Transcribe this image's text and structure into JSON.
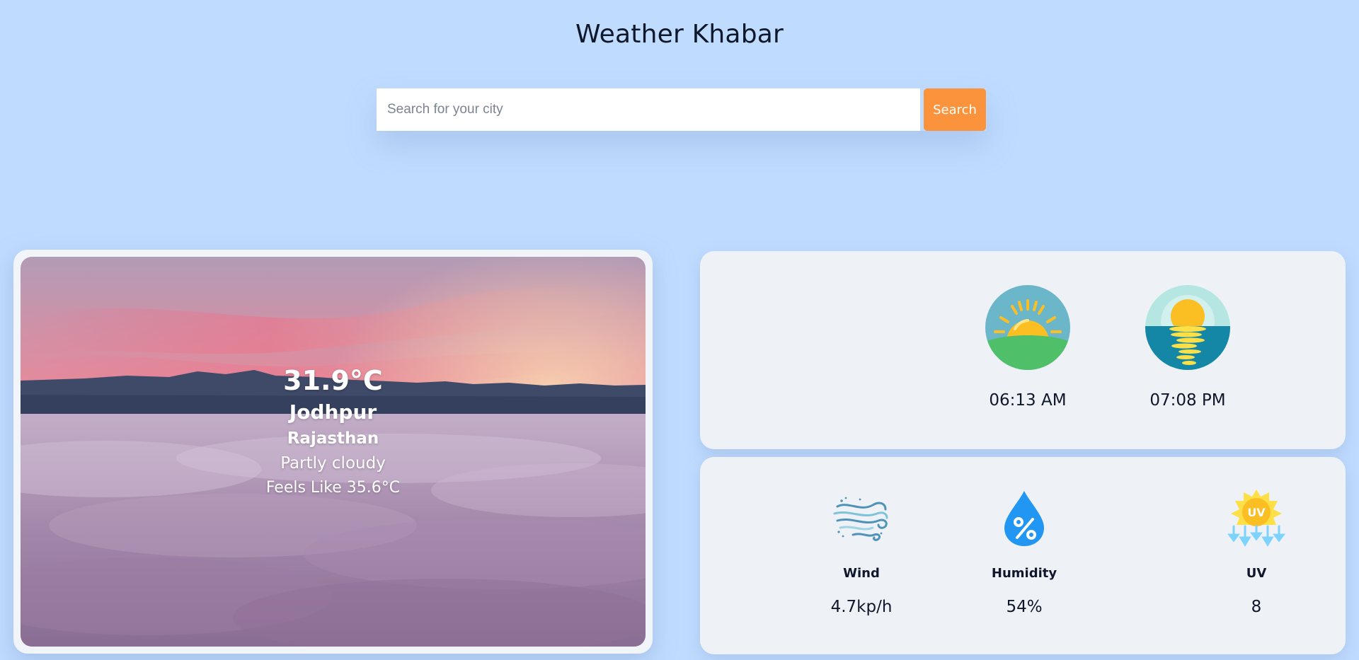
{
  "header": {
    "title": "Weather Khabar"
  },
  "search": {
    "placeholder": "Search for your city",
    "value": "",
    "button_label": "Search"
  },
  "current": {
    "temperature": "31.9°C",
    "city": "Jodhpur",
    "region": "Rajasthan",
    "condition": "Partly cloudy",
    "feels_like": "Feels Like 35.6°C",
    "background_icon": "sunrise-clouds-photo"
  },
  "sun": {
    "sunrise": {
      "icon": "sunrise-icon",
      "time": "06:13 AM"
    },
    "sunset": {
      "icon": "sunset-icon",
      "time": "07:08 PM"
    }
  },
  "stats": {
    "wind": {
      "icon": "wind-icon",
      "label": "Wind",
      "value": "4.7kp/h"
    },
    "humidity": {
      "icon": "humidity-icon",
      "label": "Humidity",
      "value": "54%"
    },
    "uv": {
      "icon": "uv-icon",
      "label": "UV",
      "value": "8"
    }
  },
  "colors": {
    "page_background": "#bfdbfe",
    "card_background": "#eef2f7",
    "search_button": "#fb923c"
  }
}
